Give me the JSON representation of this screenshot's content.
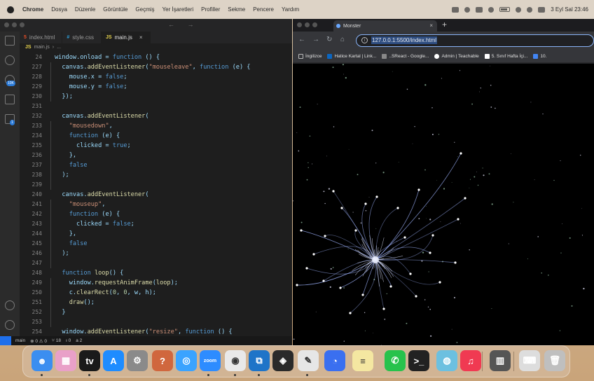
{
  "menubar": {
    "items": [
      "Chrome",
      "Dosya",
      "Düzenle",
      "Görüntüle",
      "Geçmiş",
      "Yer İşaretleri",
      "Profiller",
      "Sekme",
      "Pencere",
      "Yardım"
    ],
    "clock": "3 Eyl Sal  23:46"
  },
  "vscode": {
    "tabs": [
      {
        "label": "index.html",
        "icon": "5"
      },
      {
        "label": "style.css",
        "icon": "#"
      },
      {
        "label": "main.js",
        "icon": "JS"
      }
    ],
    "breadcrumb": [
      "JS",
      "main.js",
      "›",
      "..."
    ],
    "activity_badges": {
      "source_control": "10K",
      "extensions": "1"
    },
    "lines": [
      {
        "n": "24",
        "text": "window.onload = function () {"
      },
      {
        "n": "227",
        "text": "  canvas.addEventListener(\"mouseleave\", function (e) {"
      },
      {
        "n": "228",
        "text": "    mouse.x = false;"
      },
      {
        "n": "229",
        "text": "    mouse.y = false;"
      },
      {
        "n": "230",
        "text": "  });"
      },
      {
        "n": "231",
        "text": ""
      },
      {
        "n": "232",
        "text": "  canvas.addEventListener("
      },
      {
        "n": "233",
        "text": "    \"mousedown\","
      },
      {
        "n": "234",
        "text": "    function (e) {"
      },
      {
        "n": "235",
        "text": "      clicked = true;"
      },
      {
        "n": "236",
        "text": "    },"
      },
      {
        "n": "237",
        "text": "    false"
      },
      {
        "n": "238",
        "text": "  );"
      },
      {
        "n": "239",
        "text": ""
      },
      {
        "n": "240",
        "text": "  canvas.addEventListener("
      },
      {
        "n": "241",
        "text": "    \"mouseup\","
      },
      {
        "n": "242",
        "text": "    function (e) {"
      },
      {
        "n": "243",
        "text": "      clicked = false;"
      },
      {
        "n": "244",
        "text": "    },"
      },
      {
        "n": "245",
        "text": "    false"
      },
      {
        "n": "246",
        "text": "  );"
      },
      {
        "n": "247",
        "text": ""
      },
      {
        "n": "248",
        "text": "  function loop() {"
      },
      {
        "n": "249",
        "text": "    window.requestAnimFrame(loop);"
      },
      {
        "n": "250",
        "text": "    c.clearRect(0, 0, w, h);"
      },
      {
        "n": "251",
        "text": "    draw();"
      },
      {
        "n": "252",
        "text": "  }"
      },
      {
        "n": "253",
        "text": ""
      },
      {
        "n": "254",
        "text": "  window.addEventListener(\"resize\", function () {"
      }
    ],
    "status": {
      "branch": "main",
      "errors": "⊗ 0 ⚠ 0",
      "ports": "⑂ 18",
      "position": "ı 0",
      "msg": "a 2"
    }
  },
  "chrome": {
    "tab_title": "Monster",
    "url": "127.0.0.1:5500/index.html",
    "bookmarks": [
      "İngilizce",
      "Hatice Kartal | Link...",
      "..SReact - Google...",
      "Admin | Teachable",
      "5. Sınıf Hafta İçi...",
      "10."
    ]
  },
  "dock": {
    "apps": [
      "finder-icon",
      "launchpad-icon",
      "apple-tv-icon",
      "app-store-icon",
      "system-settings-icon",
      "help-icon",
      "safari-icon",
      "zoom-icon",
      "chrome-icon",
      "vscode-icon",
      "davinci-icon",
      "ink-icon",
      "signal-icon",
      "notes-icon",
      "whatsapp-icon",
      "terminal-icon",
      "color-picker-icon",
      "music-icon",
      "archive-icon",
      "keyboard-icon",
      "trash-icon"
    ],
    "zoom_label": "zoom"
  },
  "colors": {
    "background_gradient": "#c9a47a",
    "vscode_bg": "#1e1e1e",
    "accent_blue": "#8ab4f8",
    "tentacle_color": "#9fb4ff"
  }
}
